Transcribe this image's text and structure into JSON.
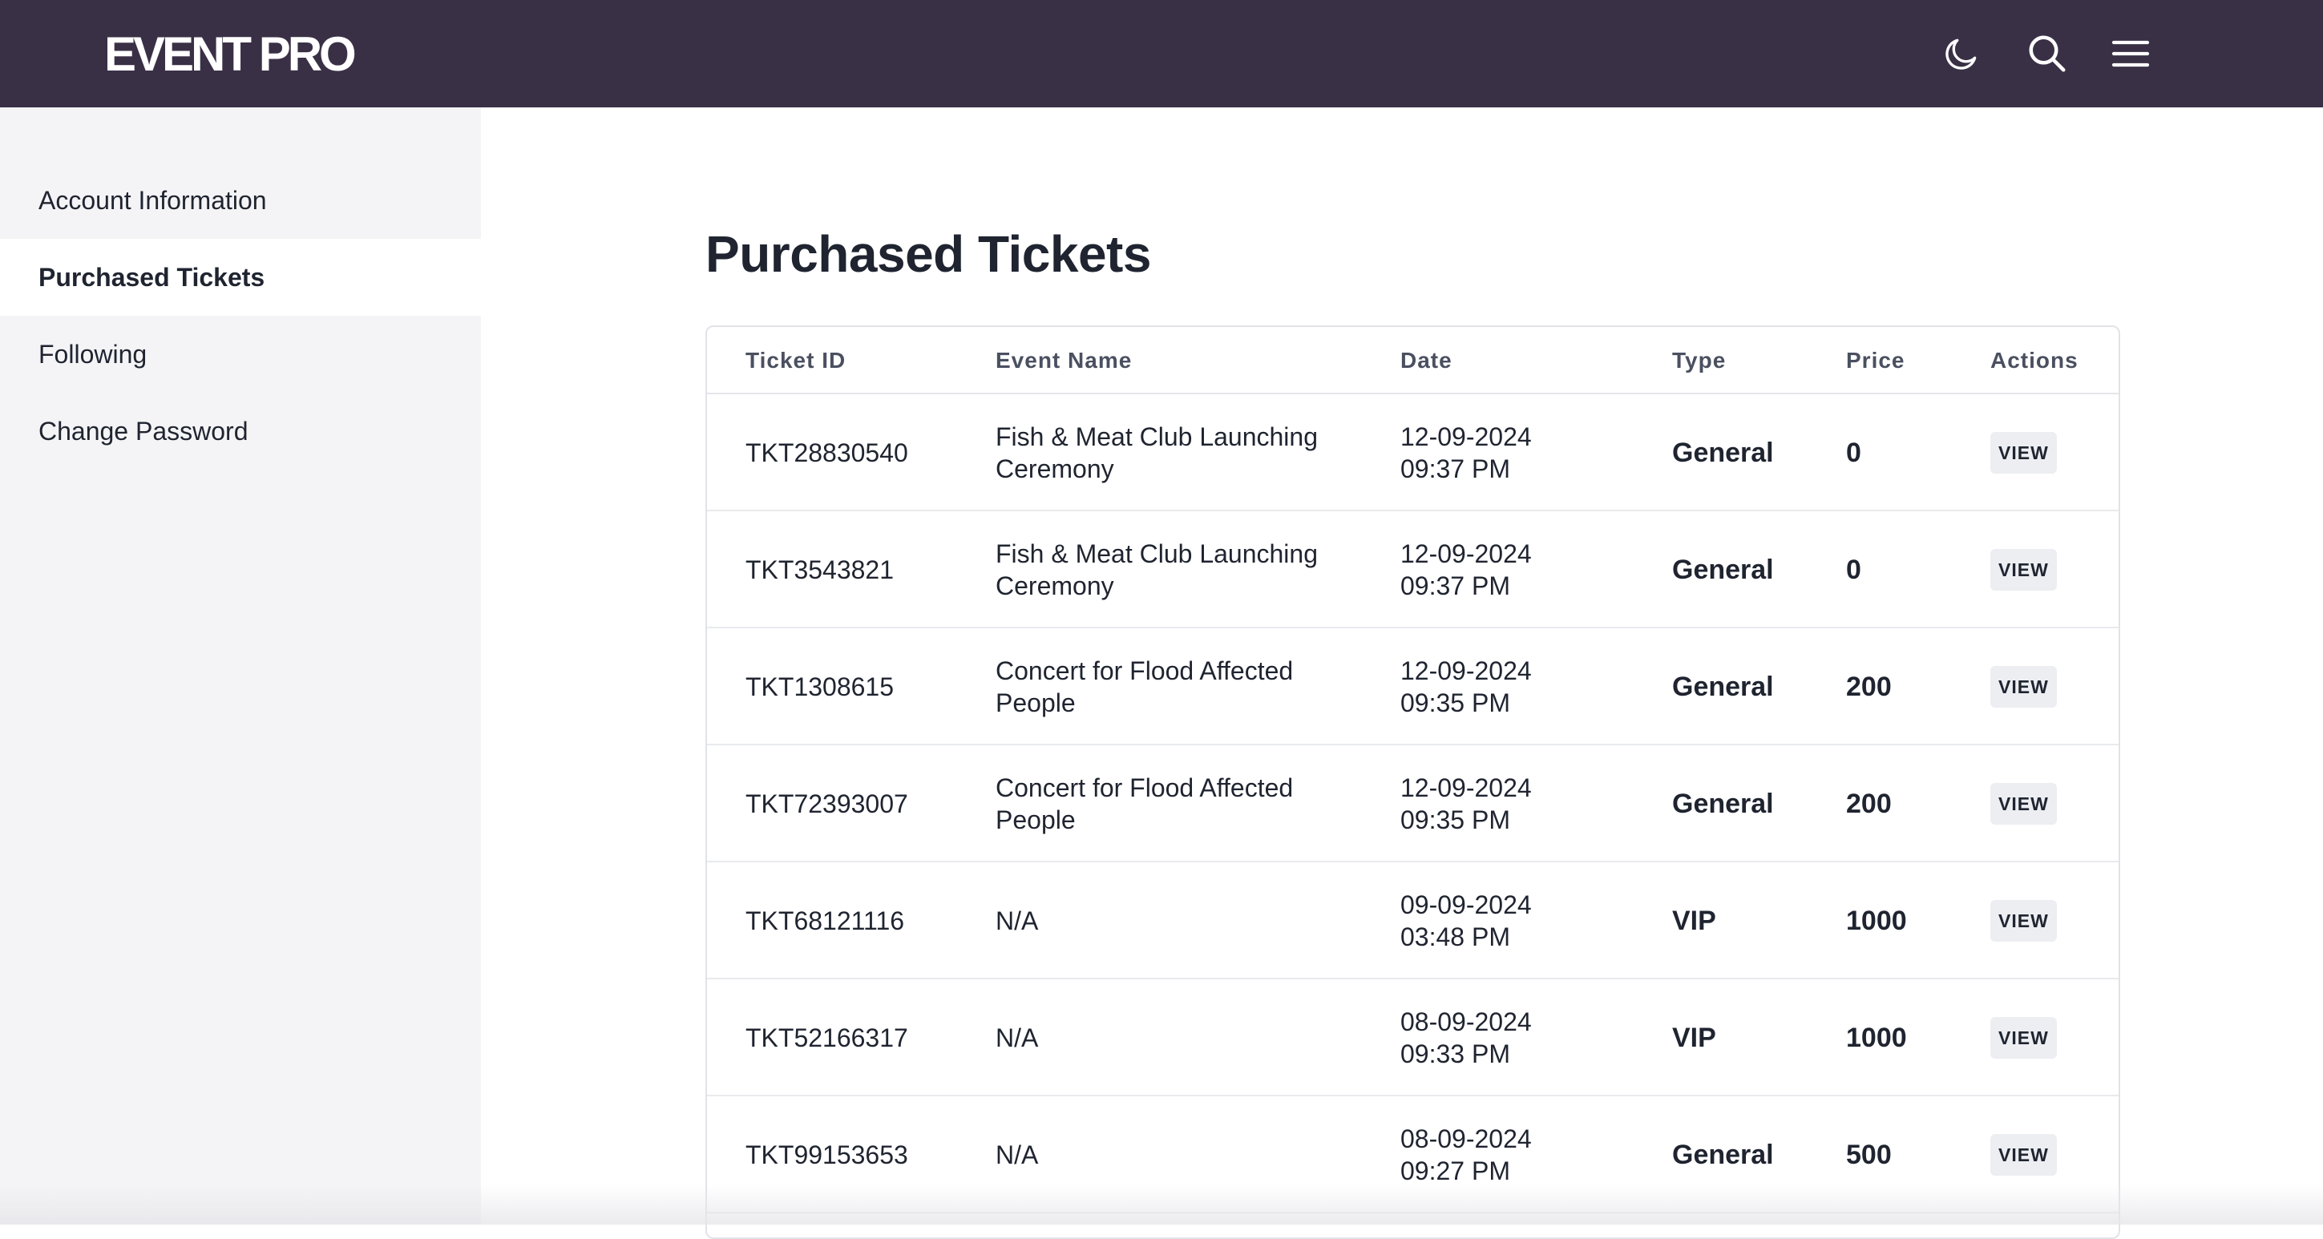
{
  "header": {
    "logo": "EVENT PRO",
    "icons": [
      "moon-icon",
      "search-icon",
      "menu-icon"
    ],
    "background": "#3a3046"
  },
  "sidebar": {
    "items": [
      {
        "label": "Account Information",
        "active": false
      },
      {
        "label": "Purchased Tickets",
        "active": true
      },
      {
        "label": "Following",
        "active": false
      },
      {
        "label": "Change Password",
        "active": false
      }
    ]
  },
  "main": {
    "title": "Purchased Tickets",
    "columns": [
      "Ticket ID",
      "Event Name",
      "Date",
      "Type",
      "Price",
      "Actions"
    ],
    "rows": [
      {
        "id": "TKT28830540",
        "event": "Fish & Meat Club Launching Ceremony",
        "date": "12-09-2024",
        "time": "09:37 PM",
        "type": "General",
        "price": "0",
        "action": "VIEW"
      },
      {
        "id": "TKT3543821",
        "event": "Fish & Meat Club Launching Ceremony",
        "date": "12-09-2024",
        "time": "09:37 PM",
        "type": "General",
        "price": "0",
        "action": "VIEW"
      },
      {
        "id": "TKT1308615",
        "event": "Concert for Flood Affected People",
        "date": "12-09-2024",
        "time": "09:35 PM",
        "type": "General",
        "price": "200",
        "action": "VIEW"
      },
      {
        "id": "TKT72393007",
        "event": "Concert for Flood Affected People",
        "date": "12-09-2024",
        "time": "09:35 PM",
        "type": "General",
        "price": "200",
        "action": "VIEW"
      },
      {
        "id": "TKT68121116",
        "event": "N/A",
        "date": "09-09-2024",
        "time": "03:48 PM",
        "type": "VIP",
        "price": "1000",
        "action": "VIEW"
      },
      {
        "id": "TKT52166317",
        "event": "N/A",
        "date": "08-09-2024",
        "time": "09:33 PM",
        "type": "VIP",
        "price": "1000",
        "action": "VIEW"
      },
      {
        "id": "TKT99153653",
        "event": "N/A",
        "date": "08-09-2024",
        "time": "09:27 PM",
        "type": "General",
        "price": "500",
        "action": "VIEW"
      }
    ]
  }
}
